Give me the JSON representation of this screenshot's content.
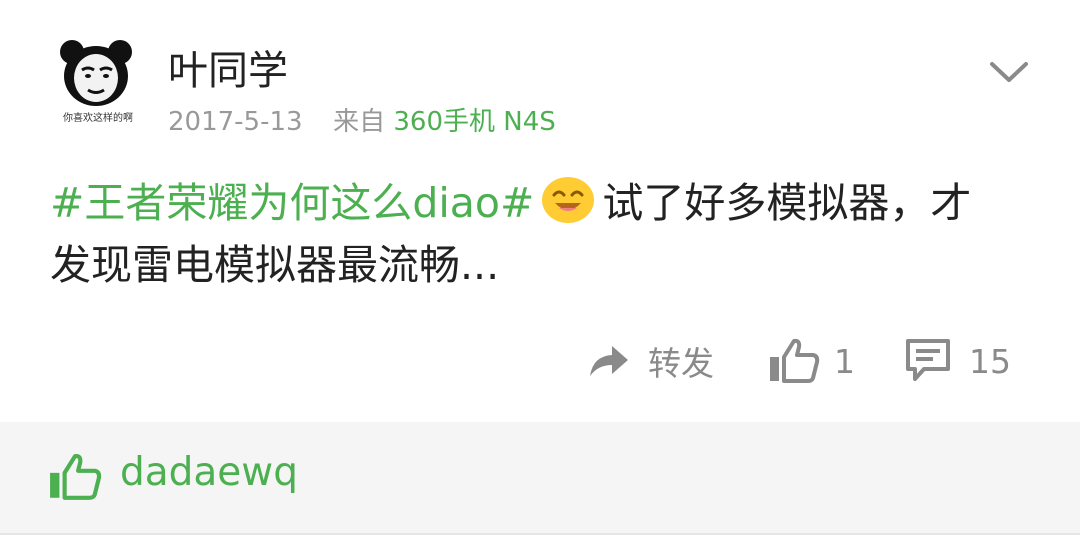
{
  "post": {
    "author": "叶同学",
    "avatar_caption": "你喜欢这样的啊",
    "date": "2017-5-13",
    "source_prefix": "来自",
    "device": "360手机 N4S",
    "hashtag": "#王者荣耀为何这么diao#",
    "text": "试了好多模拟器，才发现雷电模拟器最流畅..."
  },
  "actions": {
    "repost_label": "转发",
    "like_count": "1",
    "comment_count": "15"
  },
  "likes": {
    "users": [
      "dadaewq"
    ]
  },
  "colors": {
    "accent": "#4caf50",
    "muted": "#999999",
    "action_gray": "#8a8a8a",
    "likes_bg": "#f5f5f5"
  },
  "icons": [
    "panda-avatar",
    "chevron-down-icon",
    "smile-emoji-icon",
    "repost-arrow-icon",
    "thumbs-up-icon",
    "comment-icon"
  ]
}
